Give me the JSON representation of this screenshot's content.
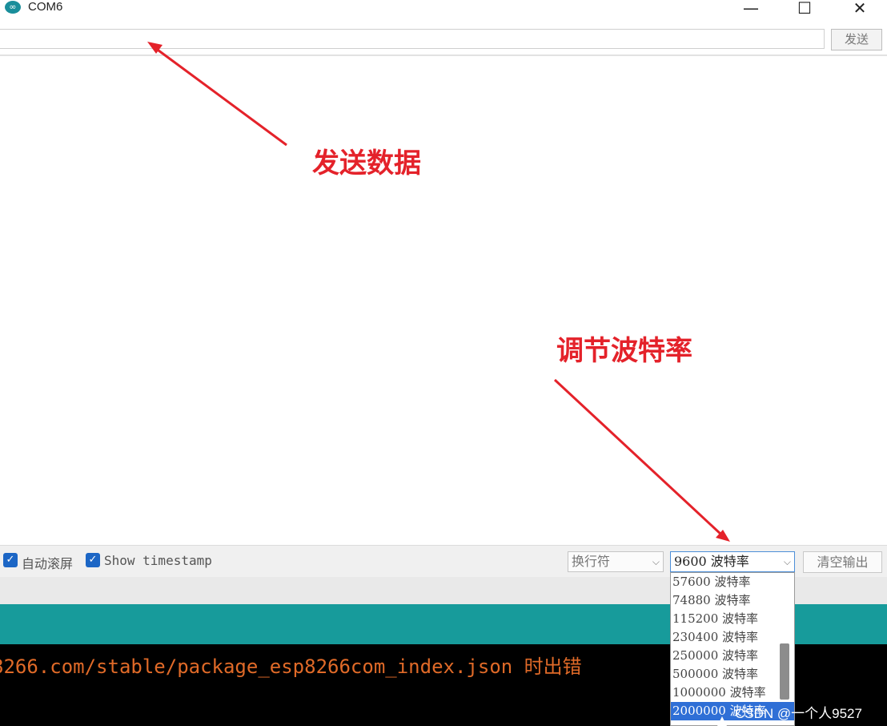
{
  "window": {
    "title": "COM6",
    "minimize": "—",
    "maximize": "☐",
    "close": "✕"
  },
  "send": {
    "input_value": "",
    "button_label": "发送"
  },
  "annotations": {
    "send_data": "发送数据",
    "adjust_baud": "调节波特率"
  },
  "bottom": {
    "autoscroll_label": "自动滚屏",
    "autoscroll_checked": true,
    "timestamp_label": "Show timestamp",
    "timestamp_checked": true,
    "line_ending_value": "换行符",
    "baud_value": "9600 波特率",
    "clear_label": "清空输出"
  },
  "dropdown": {
    "options": [
      "57600 波特率",
      "74880 波特率",
      "115200 波特率",
      "230400 波特率",
      "250000 波特率",
      "500000 波特率",
      "1000000 波特率",
      "2000000 波特率"
    ],
    "selected_index": 7
  },
  "console": {
    "text": "8266.com/stable/package_esp8266com_index.json 时出错"
  },
  "watermark": "CSDN @一个人9527",
  "colors": {
    "accent": "#179b9b",
    "annotation": "#e4222a",
    "checkbox": "#1c66c5",
    "console_text": "#e06a28"
  }
}
